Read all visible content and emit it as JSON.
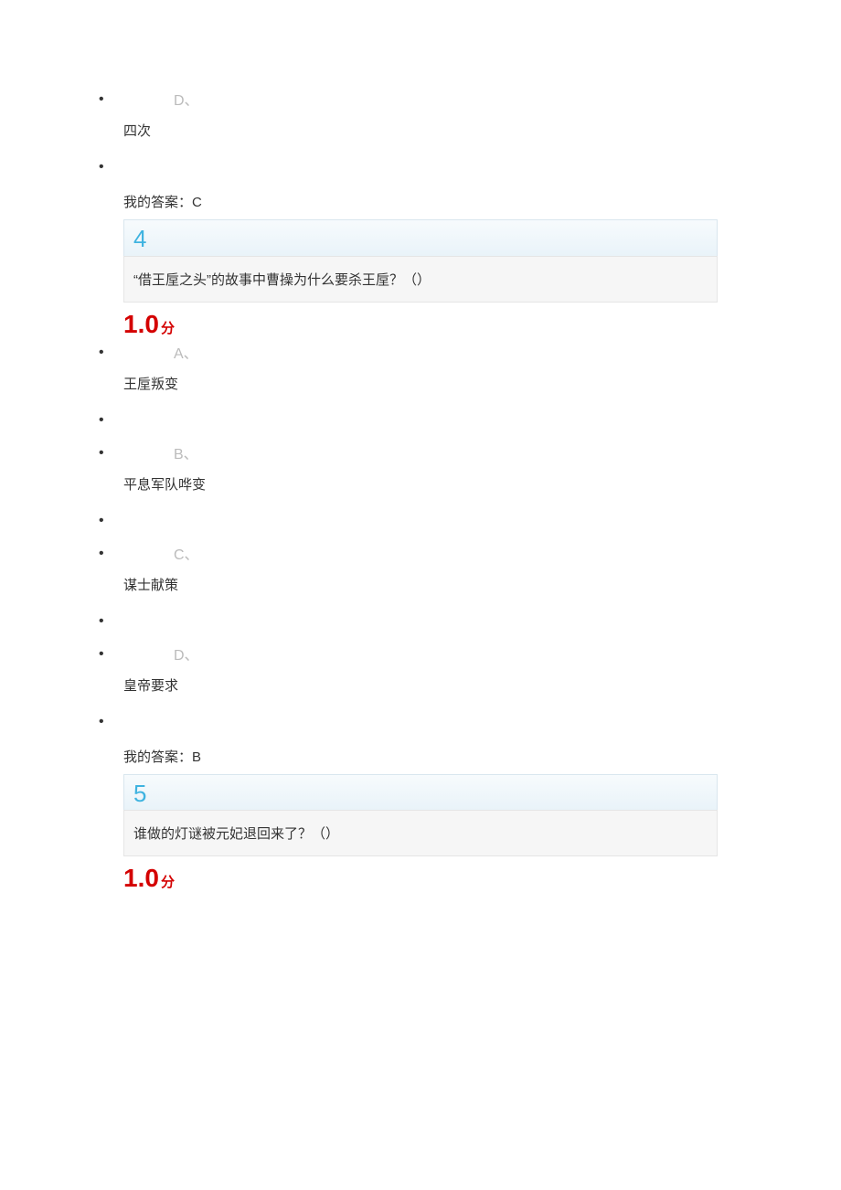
{
  "q3_tail": {
    "option_d_letter": "D、",
    "option_d_text": "四次",
    "my_answer": "我的答案：C"
  },
  "q4": {
    "number": "4",
    "question": "“借王垕之头”的故事中曹操为什么要杀王垕？（）",
    "score_value": "1.0",
    "score_unit": "分",
    "options": {
      "a_letter": "A、",
      "a_text": "王垕叛变",
      "b_letter": "B、",
      "b_text": "平息军队哗变",
      "c_letter": "C、",
      "c_text": "谋士献策",
      "d_letter": "D、",
      "d_text": "皇帝要求"
    },
    "my_answer": "我的答案：B"
  },
  "q5": {
    "number": "5",
    "question": "谁做的灯谜被元妃退回来了？（）",
    "score_value": "1.0",
    "score_unit": "分"
  }
}
